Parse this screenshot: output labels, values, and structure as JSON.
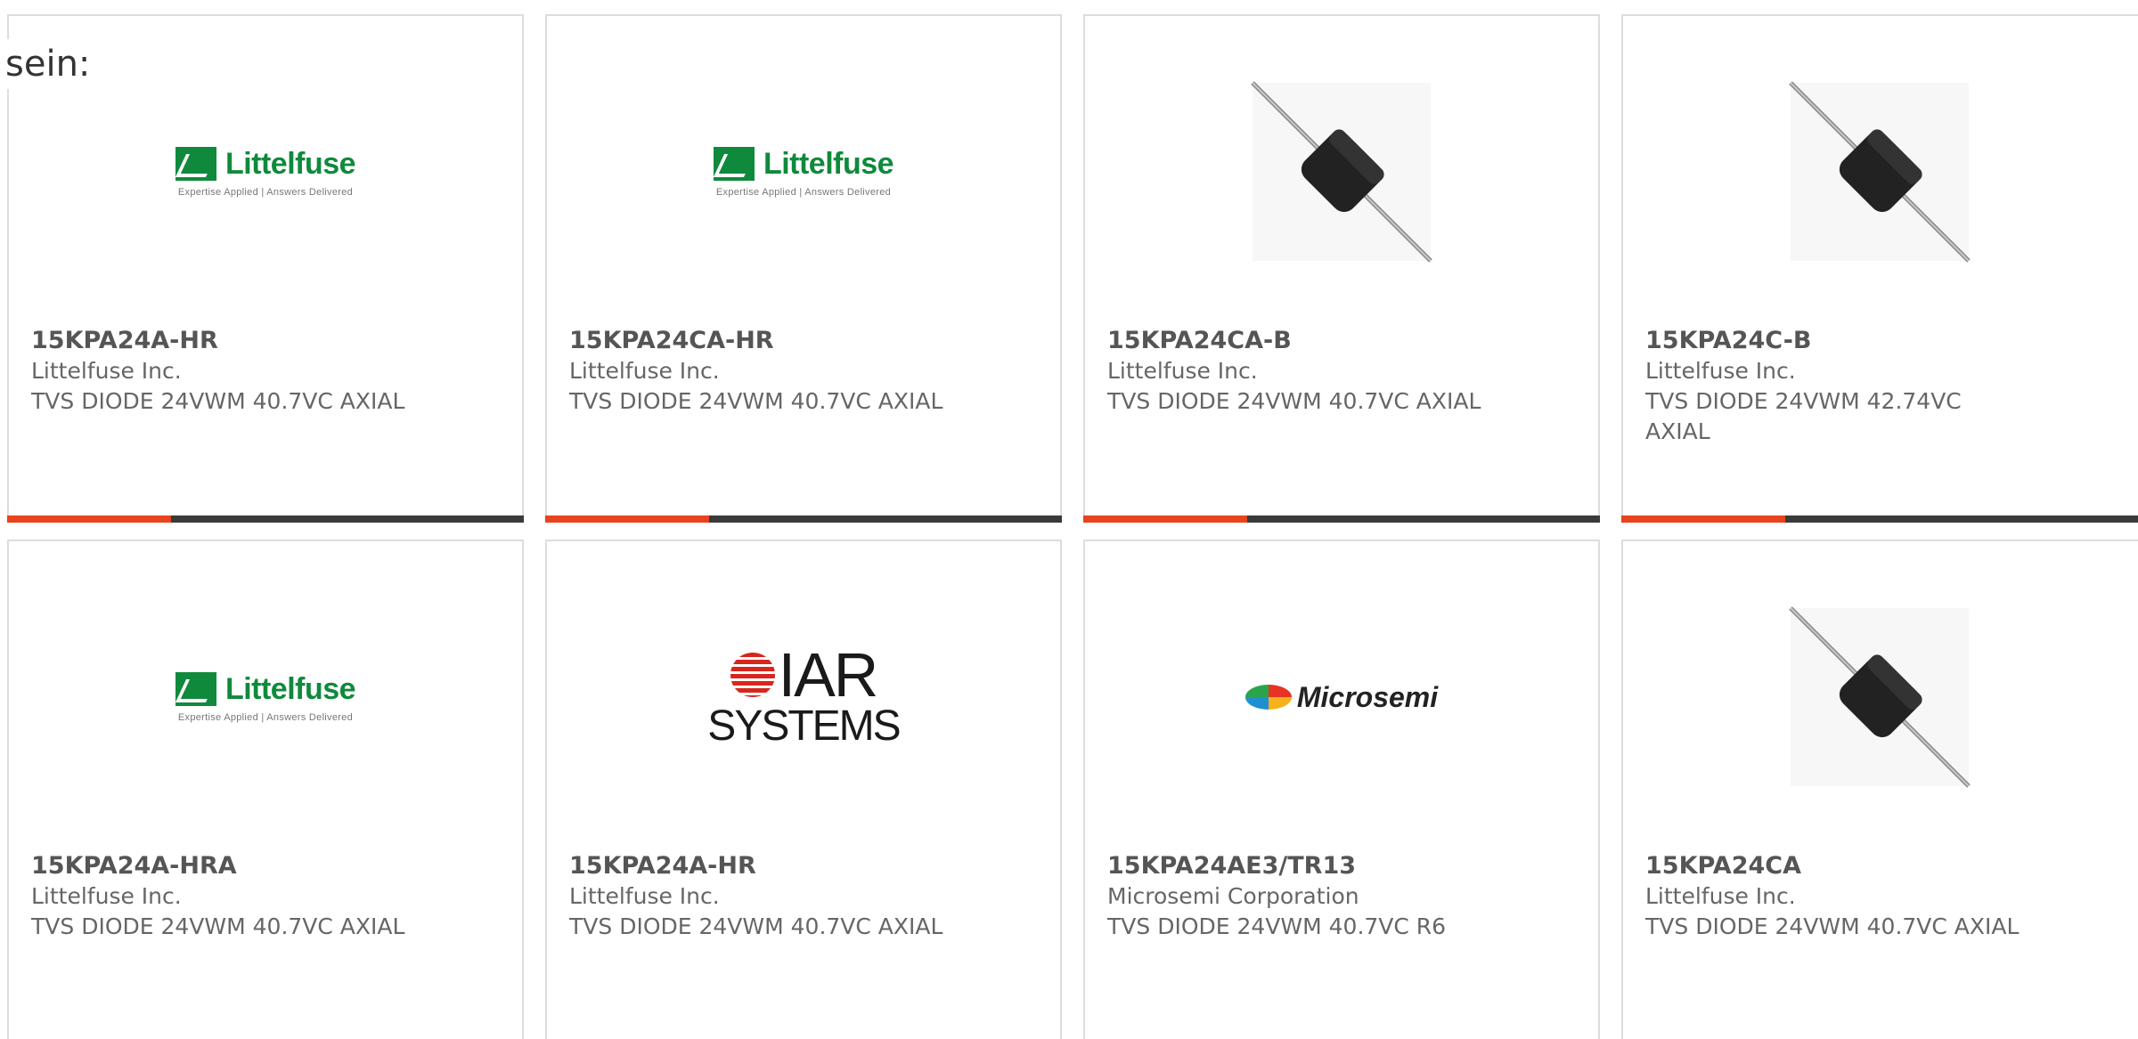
{
  "intro_text": "sein:",
  "logos": {
    "littelfuse": {
      "name": "Littelfuse",
      "tagline": "Expertise Applied | Answers Delivered"
    },
    "iar": {
      "name": "IAR",
      "subname": "SYSTEMS"
    },
    "microsemi": {
      "name": "Microsemi"
    }
  },
  "colors": {
    "accent_bar": "#e8431c",
    "base_bar": "#3a3a3a",
    "littelfuse_green": "#0f8a3c",
    "iar_red": "#d7261e"
  },
  "products": [
    {
      "part_number": "15KPA24A-HR",
      "manufacturer": "Littelfuse Inc.",
      "description": "TVS DIODE 24VWM 40.7VC AXIAL",
      "image": "littelfuse-logo"
    },
    {
      "part_number": "15KPA24CA-HR",
      "manufacturer": "Littelfuse Inc.",
      "description": "TVS DIODE 24VWM 40.7VC AXIAL",
      "image": "littelfuse-logo"
    },
    {
      "part_number": "15KPA24CA-B",
      "manufacturer": "Littelfuse Inc.",
      "description": "TVS DIODE 24VWM 40.7VC AXIAL",
      "image": "axial-diode-photo"
    },
    {
      "part_number": "15KPA24C-B",
      "manufacturer": "Littelfuse Inc.",
      "description": "TVS DIODE 24VWM 42.74VC AXIAL",
      "image": "axial-diode-photo"
    },
    {
      "part_number": "15KPA24A-HRA",
      "manufacturer": "Littelfuse Inc.",
      "description": "TVS DIODE 24VWM 40.7VC AXIAL",
      "image": "littelfuse-logo"
    },
    {
      "part_number": "15KPA24A-HR",
      "manufacturer": "Littelfuse Inc.",
      "description": "TVS DIODE 24VWM 40.7VC AXIAL",
      "image": "iar-systems-logo"
    },
    {
      "part_number": "15KPA24AE3/TR13",
      "manufacturer": "Microsemi Corporation",
      "description": "TVS DIODE 24VWM 40.7VC R6",
      "image": "microsemi-logo"
    },
    {
      "part_number": "15KPA24CA",
      "manufacturer": "Littelfuse Inc.",
      "description": "TVS DIODE 24VWM 40.7VC AXIAL",
      "image": "axial-diode-photo"
    }
  ]
}
